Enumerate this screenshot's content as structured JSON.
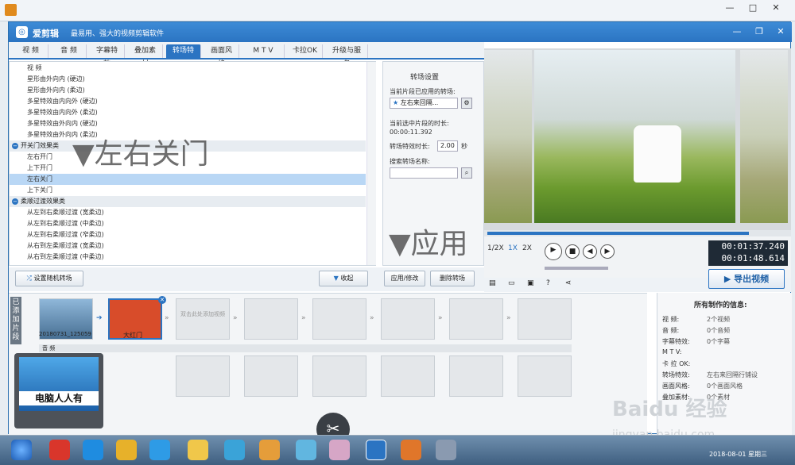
{
  "app": {
    "name": "爱剪辑",
    "slogan": "最易用、强大的视频剪辑软件"
  },
  "tabs": [
    "视  频",
    "音  频",
    "字幕特效",
    "叠加素材",
    "转场特效",
    "画面风格",
    "M T V",
    "卡拉OK",
    "升级与服务"
  ],
  "active_tab": 4,
  "effect_list": [
    {
      "type": "item",
      "label": "视  频"
    },
    {
      "type": "item",
      "label": "星形由外向内 (硬边)"
    },
    {
      "type": "item",
      "label": "星形由外向内 (柔边)"
    },
    {
      "type": "item",
      "label": "多星特效由内向外 (硬边)"
    },
    {
      "type": "item",
      "label": "多星特效由内向外 (柔边)"
    },
    {
      "type": "item",
      "label": "多星特效由外向内 (硬边)"
    },
    {
      "type": "item",
      "label": "多星特效由外向内 (柔边)"
    },
    {
      "type": "cat",
      "label": "开关门效果类"
    },
    {
      "type": "item",
      "label": "左右开门"
    },
    {
      "type": "item",
      "label": "上下开门"
    },
    {
      "type": "item",
      "label": "左右关门",
      "selected": true
    },
    {
      "type": "item",
      "label": "上下关门"
    },
    {
      "type": "cat",
      "label": "柔顺过渡效果类"
    },
    {
      "type": "item",
      "label": "从左到右柔顺过渡 (宽柔边)"
    },
    {
      "type": "item",
      "label": "从左到右柔顺过渡 (中柔边)"
    },
    {
      "type": "item",
      "label": "从左到右柔顺过渡 (窄柔边)"
    },
    {
      "type": "item",
      "label": "从右到左柔顺过渡 (宽柔边)"
    },
    {
      "type": "item",
      "label": "从右到左柔顺过渡 (中柔边)"
    }
  ],
  "annotations": {
    "left": "▼左右关门",
    "right": "▼应用"
  },
  "settings": {
    "title": "转场设置",
    "current_label": "当前片段已应用的转场:",
    "current_value": "左右来回隔...",
    "duration_label": "当前选中片段的时长:",
    "duration_value": "00:00:11.392",
    "effect_duration_label": "转场特效时长:",
    "effect_duration_value": "2.00",
    "effect_duration_unit": "秒",
    "search_label": "搜索转场名称:",
    "search_value": ""
  },
  "buttons": {
    "random": "设置随机转场",
    "collapse": "收起",
    "apply": "应用/修改",
    "delete": "删除转场",
    "export": "导出视频"
  },
  "player": {
    "speeds": [
      "1/2X",
      "1X",
      "2X"
    ],
    "time_current": "00:01:37.240",
    "time_total": "00:01:48.614",
    "progress": 0.87
  },
  "timeline": {
    "label": "已添加片段",
    "clips": [
      {
        "name": "20180731_125059"
      },
      {
        "name": "大红门"
      }
    ],
    "placeholder": "双击此处添加视频",
    "audio_label": "音  频"
  },
  "info": {
    "title": "所有制作的信息:",
    "rows": [
      {
        "k": "视    频:",
        "v": "2个视频"
      },
      {
        "k": "音    频:",
        "v": "0个音频"
      },
      {
        "k": "字幕特效:",
        "v": "0个字幕"
      },
      {
        "k": "M  T  V:",
        "v": ""
      },
      {
        "k": "卡 拉 OK:",
        "v": ""
      },
      {
        "k": "转场特效:",
        "v": "左右来回隔行铺设"
      },
      {
        "k": "画面风格:",
        "v": "0个画面风格"
      },
      {
        "k": "叠加素材:",
        "v": "0个素材"
      }
    ]
  },
  "logo_text": "电脑人人有",
  "clock": "2018-08-01 星期三",
  "watermark": {
    "line1": "Baidu 经验",
    "line2": "jingyan.baidu.com"
  },
  "colors": {
    "accent": "#2b74c2",
    "selected": "#b9d7f5"
  }
}
